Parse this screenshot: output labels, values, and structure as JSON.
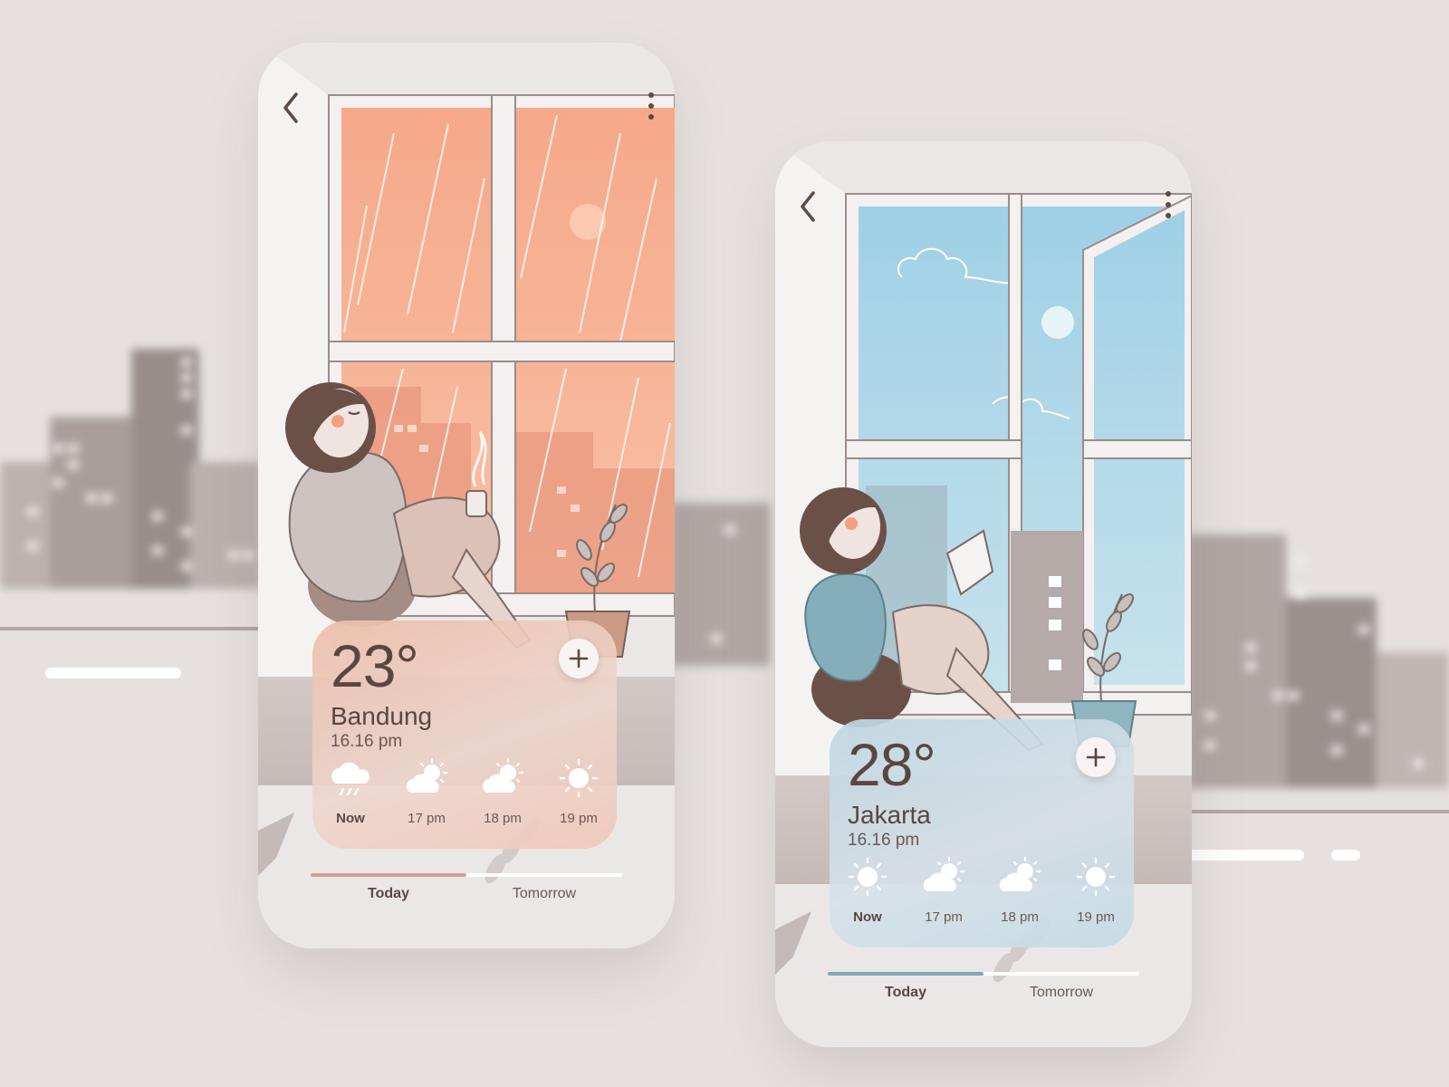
{
  "colors": {
    "background": "#e6e1df",
    "text_dark": "#5a4641",
    "accent_warm": "#c9a391",
    "accent_cool": "#7fa9b8",
    "sky_rain": "#f5ab8b",
    "sky_clear": "#a3d2e6"
  },
  "screens": [
    {
      "city": "Bandung",
      "temperature": "23°",
      "time": "16.16 pm",
      "condition_scene": "rainy-window",
      "forecast": [
        {
          "label": "Now",
          "icon": "cloud-rain-icon"
        },
        {
          "label": "17 pm",
          "icon": "sun-cloud-icon"
        },
        {
          "label": "18 pm",
          "icon": "sun-cloud-icon"
        },
        {
          "label": "19 pm",
          "icon": "sun-icon"
        }
      ],
      "tabs": {
        "today": "Today",
        "tomorrow": "Tomorrow",
        "active": "Today"
      }
    },
    {
      "city": "Jakarta",
      "temperature": "28°",
      "time": "16.16 pm",
      "condition_scene": "sunny-window",
      "forecast": [
        {
          "label": "Now",
          "icon": "sun-icon"
        },
        {
          "label": "17 pm",
          "icon": "sun-cloud-icon"
        },
        {
          "label": "18 pm",
          "icon": "sun-cloud-icon"
        },
        {
          "label": "19 pm",
          "icon": "sun-icon"
        }
      ],
      "tabs": {
        "today": "Today",
        "tomorrow": "Tomorrow",
        "active": "Today"
      }
    }
  ]
}
